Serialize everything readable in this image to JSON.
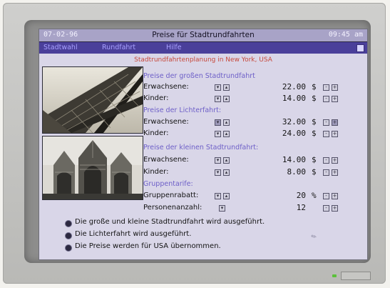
{
  "window": {
    "date": "07-02-96",
    "title": "Preise für Stadtrundfahrten",
    "time": "09:45 am"
  },
  "menu": {
    "items": [
      "Stadtwahl",
      "Rundfahrt",
      "Hilfe"
    ]
  },
  "subtitle": "Stadtrundfahrtenplanung in New York, USA",
  "photos": {
    "top": "eiffel-tower-photo",
    "bottom": "gothic-building-photo"
  },
  "sections": {
    "gross": {
      "title": "Preise der großen Stadtrundfahrt",
      "rows": [
        {
          "label": "Erwachsene:",
          "value": "22.00",
          "unit": "$"
        },
        {
          "label": "Kinder:",
          "value": "14.00",
          "unit": "$"
        }
      ]
    },
    "licht": {
      "title": "Preise der Lichterfahrt:",
      "rows": [
        {
          "label": "Erwachsene:",
          "value": "32.00",
          "unit": "$"
        },
        {
          "label": "Kinder:",
          "value": "24.00",
          "unit": "$"
        }
      ]
    },
    "klein": {
      "title": "Preise der kleinen Stadtrundfahrt:",
      "rows": [
        {
          "label": "Erwachsene:",
          "value": "14.00",
          "unit": "$"
        },
        {
          "label": "Kinder:",
          "value": "8.00",
          "unit": "$"
        }
      ]
    },
    "gruppe": {
      "title": "Gruppentarife:",
      "rows": [
        {
          "label": "Gruppenrabatt:",
          "value": "20",
          "unit": "%"
        },
        {
          "label": "Personenanzahl:",
          "value": "12",
          "unit": ""
        }
      ]
    }
  },
  "options": [
    "Die große und kleine Stadtrundfahrt wird ausgeführt.",
    "Die Lichterfahrt wird ausgeführt.",
    "Die Preise werden für USA übernommen."
  ],
  "colors": {
    "screen": "#d9d6e8",
    "menubar": "#4a3f9a",
    "section_title": "#6e60c8",
    "subtitle": "#c7483a"
  }
}
